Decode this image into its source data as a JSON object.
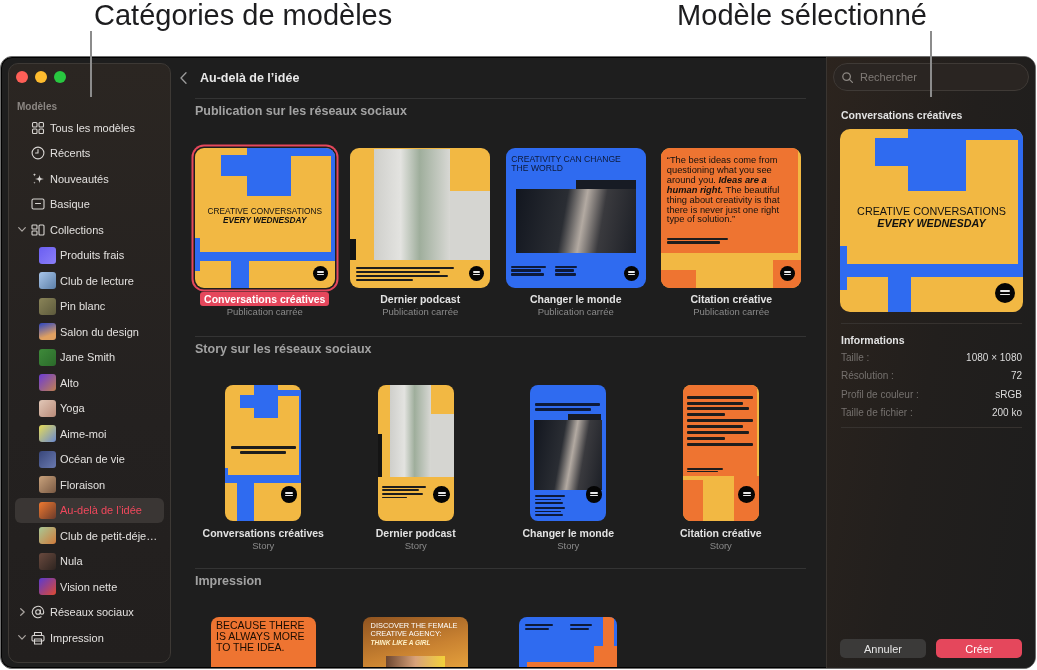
{
  "callouts": [
    "Catégories de modèles",
    "Modèle sélectionné"
  ],
  "sidebar": {
    "section_label": "Modèles",
    "items": [
      {
        "label": "Tous les modèles",
        "selected": false
      },
      {
        "label": "Récents",
        "selected": false
      },
      {
        "label": "Nouveautés",
        "selected": false
      },
      {
        "label": "Basique",
        "selected": false
      },
      {
        "label": "Collections",
        "selected": false,
        "expanded": true,
        "children": [
          {
            "label": "Produits frais",
            "selected": false
          },
          {
            "label": "Club de lecture",
            "selected": false
          },
          {
            "label": "Pin blanc",
            "selected": false
          },
          {
            "label": "Salon du design",
            "selected": false
          },
          {
            "label": "Jane Smith",
            "selected": false
          },
          {
            "label": "Alto",
            "selected": false
          },
          {
            "label": "Yoga",
            "selected": false
          },
          {
            "label": "Aime-moi",
            "selected": false
          },
          {
            "label": "Océan de vie",
            "selected": false
          },
          {
            "label": "Floraison",
            "selected": false
          },
          {
            "label": "Au-delà de l’idée",
            "selected": true
          },
          {
            "label": "Club de petit-déje…",
            "selected": false
          },
          {
            "label": "Nula",
            "selected": false
          },
          {
            "label": "Vision nette",
            "selected": false
          }
        ]
      },
      {
        "label": "Réseaux sociaux",
        "selected": false,
        "expanded": false
      },
      {
        "label": "Impression",
        "selected": false,
        "expanded": true
      }
    ]
  },
  "main": {
    "title": "Au-delà de l’idée",
    "sections": [
      {
        "title": "Publication sur les réseaux sociaux",
        "kind": "square",
        "templates": [
          {
            "name": "Conversations créatives",
            "type": "Publication carrée",
            "selected": true,
            "design": {
              "kind": "blocks",
              "headline": "CREATIVE CONVERSATIONS",
              "tagline": "EVERY WEDNESDAY"
            }
          },
          {
            "name": "Dernier podcast",
            "type": "Publication carrée",
            "selected": false,
            "design": {
              "kind": "podcast"
            }
          },
          {
            "name": "Changer le monde",
            "type": "Publication carrée",
            "selected": false,
            "design": {
              "kind": "world",
              "headline": "CREATIVITY CAN CHANGE THE WORLD"
            }
          },
          {
            "name": "Citation créative",
            "type": "Publication carrée",
            "selected": false,
            "design": {
              "kind": "quote",
              "quote": "“The best ideas come from questioning what you see around you. **Ideas are a human right.** The beautiful thing about creativity is that there is never just one right type of solution.”"
            }
          }
        ]
      },
      {
        "title": "Story sur les réseaux sociaux",
        "kind": "story",
        "templates": [
          {
            "name": "Conversations créatives",
            "type": "Story",
            "selected": false,
            "design": {
              "kind": "blocks"
            }
          },
          {
            "name": "Dernier podcast",
            "type": "Story",
            "selected": false,
            "design": {
              "kind": "podcast"
            }
          },
          {
            "name": "Changer le monde",
            "type": "Story",
            "selected": false,
            "design": {
              "kind": "world"
            }
          },
          {
            "name": "Citation créative",
            "type": "Story",
            "selected": false,
            "design": {
              "kind": "quote"
            }
          }
        ]
      },
      {
        "title": "Impression",
        "kind": "print",
        "templates": [
          {
            "design": {
              "kind": "poster",
              "headline": "BECAUSE THERE IS ALWAYS MORE TO THE IDEA."
            }
          },
          {
            "design": {
              "kind": "flyer",
              "headline": "DISCOVER THE FEMALE CREATIVE AGENCY:",
              "tagline": "THINK LIKE A GIRL"
            }
          },
          {
            "design": {
              "kind": "event"
            }
          }
        ]
      }
    ]
  },
  "inspector": {
    "search": {
      "placeholder": "Rechercher"
    },
    "title": "Conversations créatives",
    "preview": {
      "kind": "blocks",
      "headline": "CREATIVE CONVERSATIONS",
      "tagline": "EVERY WEDNESDAY"
    },
    "info_title": "Informations",
    "info": [
      {
        "label": "Taille :",
        "value": "1080 × 1080"
      },
      {
        "label": "Résolution :",
        "value": "72"
      },
      {
        "label": "Profil de couleur :",
        "value": "sRGB"
      },
      {
        "label": "Taille de fichier :",
        "value": "200 ko"
      }
    ],
    "buttons": [
      {
        "label": "Annuler",
        "kind": "secondary"
      },
      {
        "label": "Créer",
        "kind": "primary"
      }
    ]
  }
}
